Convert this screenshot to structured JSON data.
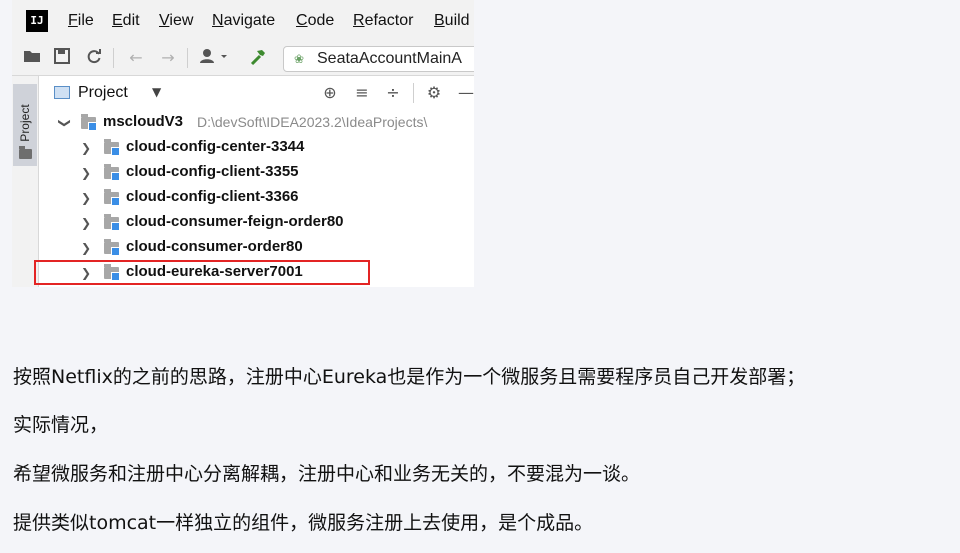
{
  "menubar": {
    "logo": "IJ",
    "items": [
      {
        "label": "File",
        "mnemonic": "F",
        "rest": "ile"
      },
      {
        "label": "Edit",
        "mnemonic": "E",
        "rest": "dit"
      },
      {
        "label": "View",
        "mnemonic": "V",
        "rest": "iew"
      },
      {
        "label": "Navigate",
        "mnemonic": "N",
        "rest": "avigate"
      },
      {
        "label": "Code",
        "mnemonic": "C",
        "rest": "ode"
      },
      {
        "label": "Refactor",
        "mnemonic": "R",
        "rest": "efactor"
      },
      {
        "label": "Build",
        "mnemonic": "B",
        "rest": "uild"
      }
    ]
  },
  "toolbar": {
    "icons": [
      "open-folder-icon",
      "save-icon",
      "sync-icon",
      "back-arrow-icon",
      "forward-arrow-icon",
      "user-icon",
      "hammer-icon"
    ],
    "run_config": "SeataAccountMainA"
  },
  "side_strip": {
    "tab_label": "Project"
  },
  "project_panel": {
    "title": "Project",
    "root": {
      "name": "mscloudV3",
      "path": "D:\\devSoft\\IDEA2023.2\\IdeaProjects\\"
    },
    "modules": [
      "cloud-config-center-3344",
      "cloud-config-client-3355",
      "cloud-config-client-3366",
      "cloud-consumer-feign-order80",
      "cloud-consumer-order80",
      "cloud-eureka-server7001"
    ]
  },
  "article": {
    "paragraphs": [
      "按照Netflix的之前的思路，注册中心Eureka也是作为一个微服务且需要程序员自己开发部署；",
      "实际情况，",
      "希望微服务和注册中心分离解耦，注册中心和业务无关的，不要混为一谈。",
      "提供类似tomcat一样独立的组件，微服务注册上去使用，是个成品。"
    ]
  },
  "colors": {
    "highlight": "#e32424",
    "module_badge": "#3a8ee6",
    "background": "#f4f5f9"
  }
}
